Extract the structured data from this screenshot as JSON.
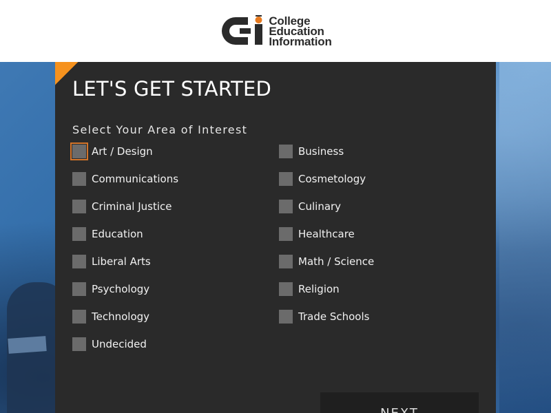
{
  "header": {
    "logo_line1": "College",
    "logo_line2": "Education",
    "logo_line3": "Information"
  },
  "form": {
    "title": "LET'S GET STARTED",
    "subtitle": "Select Your Area of Interest",
    "options_left": [
      "Art / Design",
      "Communications",
      "Criminal Justice",
      "Education",
      "Liberal Arts",
      "Psychology",
      "Technology",
      "Undecided"
    ],
    "options_right": [
      "Business",
      "Cosmetology",
      "Culinary",
      "Healthcare",
      "Math / Science",
      "Religion",
      "Trade Schools"
    ],
    "next_label": "NEXT"
  },
  "colors": {
    "accent": "#f6921e",
    "panel": "#2a2a2a",
    "checkbox": "#6b6b6b"
  }
}
